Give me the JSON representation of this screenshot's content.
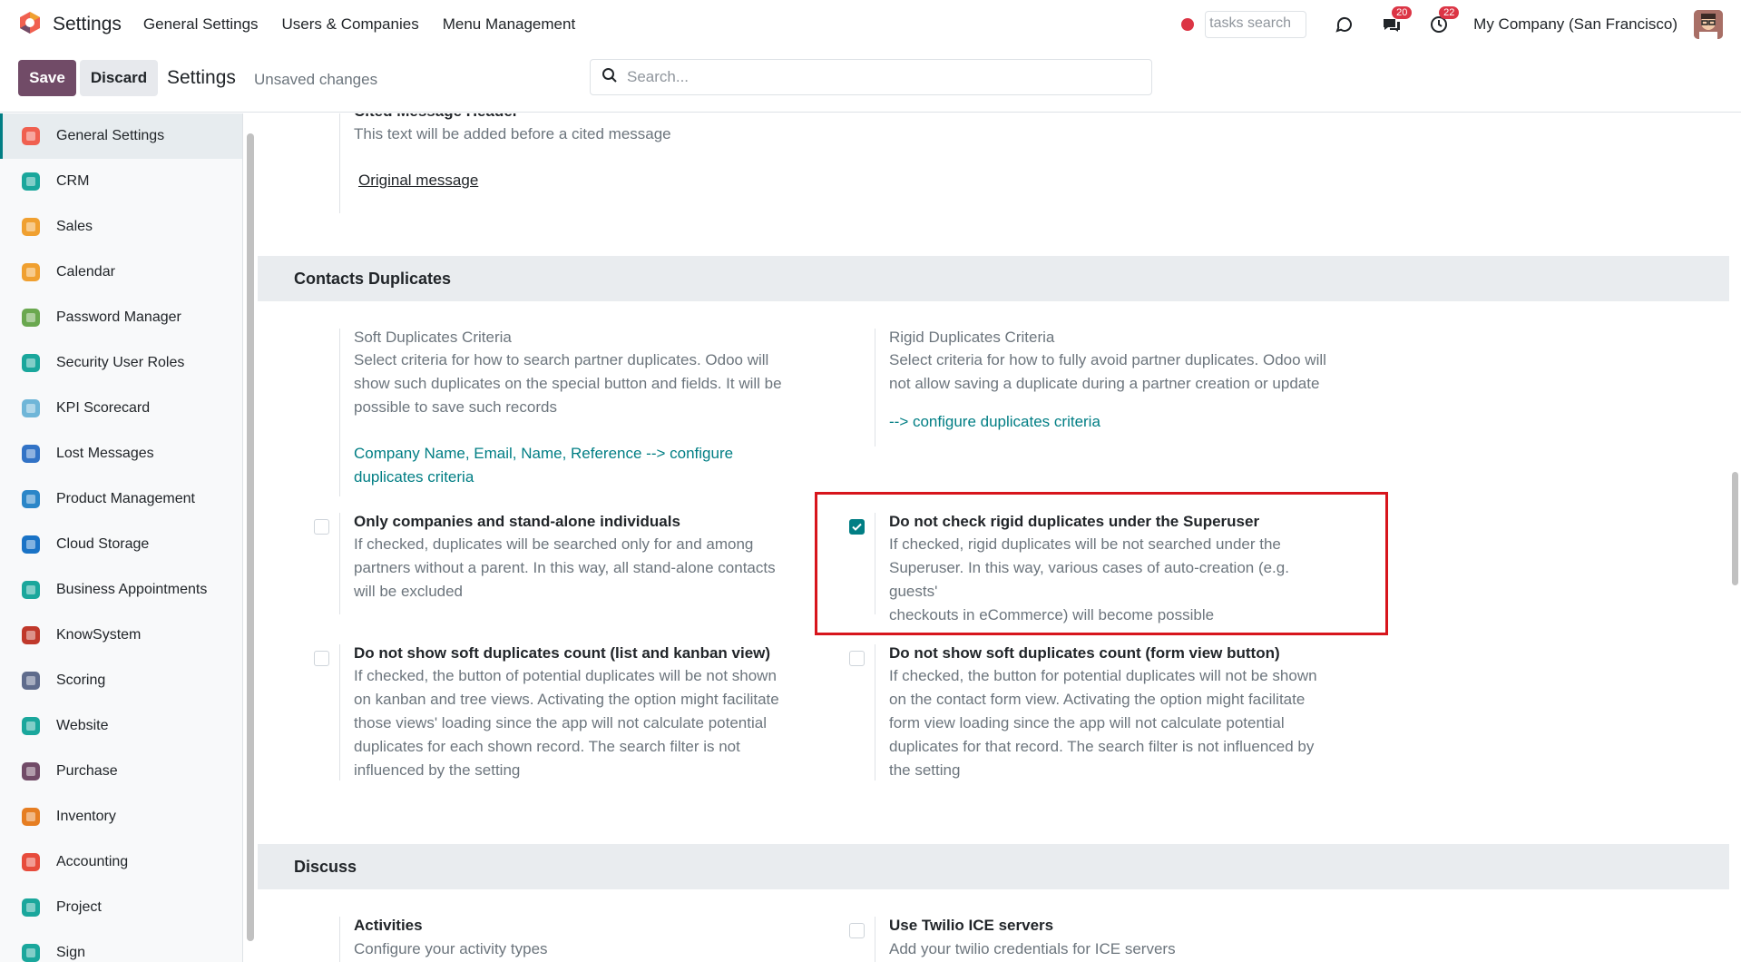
{
  "navbar": {
    "app_title": "Settings",
    "menus": [
      "General Settings",
      "Users & Companies",
      "Menu Management"
    ],
    "tasks_search_placeholder": "tasks search",
    "chat_badge": "20",
    "activity_badge": "22",
    "company": "My Company (San Francisco)"
  },
  "control_panel": {
    "save_label": "Save",
    "discard_label": "Discard",
    "title": "Settings",
    "status": "Unsaved changes",
    "search_placeholder": "Search..."
  },
  "sidebar": {
    "items": [
      {
        "label": "General Settings",
        "icon": "odoo-icon",
        "color": "#f06050"
      },
      {
        "label": "CRM",
        "icon": "crm-icon",
        "color": "#1aa79c"
      },
      {
        "label": "Sales",
        "icon": "sales-icon",
        "color": "#f0a030"
      },
      {
        "label": "Calendar",
        "icon": "calendar-icon",
        "color": "#f0a030"
      },
      {
        "label": "Password Manager",
        "icon": "password-icon",
        "color": "#6aa84f"
      },
      {
        "label": "Security User Roles",
        "icon": "security-icon",
        "color": "#1aa79c"
      },
      {
        "label": "KPI Scorecard",
        "icon": "kpi-icon",
        "color": "#6fb6d8"
      },
      {
        "label": "Lost Messages",
        "icon": "user-icon",
        "color": "#3273c6"
      },
      {
        "label": "Product Management",
        "icon": "product-icon",
        "color": "#2a86c8"
      },
      {
        "label": "Cloud Storage",
        "icon": "cloud-icon",
        "color": "#1a73c6"
      },
      {
        "label": "Business Appointments",
        "icon": "appointment-icon",
        "color": "#1aa79c"
      },
      {
        "label": "KnowSystem",
        "icon": "books-icon",
        "color": "#c0392b"
      },
      {
        "label": "Scoring",
        "icon": "scoring-icon",
        "color": "#5f6c8c"
      },
      {
        "label": "Website",
        "icon": "website-icon",
        "color": "#1aa79c"
      },
      {
        "label": "Purchase",
        "icon": "purchase-icon",
        "color": "#714b67"
      },
      {
        "label": "Inventory",
        "icon": "inventory-icon",
        "color": "#e67e22"
      },
      {
        "label": "Accounting",
        "icon": "accounting-icon",
        "color": "#e74c3c"
      },
      {
        "label": "Project",
        "icon": "project-icon",
        "color": "#1aa79c"
      },
      {
        "label": "Sign",
        "icon": "sign-icon",
        "color": "#1aa79c"
      }
    ]
  },
  "main": {
    "cited": {
      "partial_title": "Cited Message Header",
      "desc": "This text will be added before a cited message",
      "link": "Original message"
    },
    "contacts_duplicates": {
      "header": "Contacts Duplicates",
      "soft": {
        "title": "Soft Duplicates Criteria",
        "desc_lines": [
          "Select criteria for how to search partner duplicates. Odoo will",
          "show such duplicates on the special button and fields. It will be",
          "possible to save such records"
        ],
        "link_lines": [
          "Company Name, Email, Name, Reference --> configure",
          "duplicates criteria"
        ]
      },
      "rigid": {
        "title": "Rigid Duplicates Criteria",
        "desc_lines": [
          "Select criteria for how to fully avoid partner duplicates. Odoo will",
          "not allow saving a duplicate during a partner creation or update"
        ],
        "link": "--> configure duplicates criteria"
      },
      "only_companies": {
        "title": "Only companies and stand-alone individuals",
        "checked": false,
        "desc_lines": [
          "If checked, duplicates will be searched only for and among",
          "partners without a parent. In this way, all stand-alone contacts",
          "will be excluded"
        ]
      },
      "no_rigid_superuser": {
        "title": "Do not check rigid duplicates under the Superuser",
        "checked": true,
        "desc_lines": [
          "If checked, rigid duplicates will be not searched under the",
          "Superuser. In this way, various cases of auto-creation (e.g. guests'",
          "checkouts in eCommerce) will become possible"
        ]
      },
      "no_soft_list": {
        "title": "Do not show soft duplicates count (list and kanban view)",
        "checked": false,
        "desc_lines": [
          "If checked, the button of potential duplicates will be not shown",
          "on kanban and tree views. Activating the option might facilitate",
          "those views' loading since the app will not calculate potential",
          "duplicates for each shown record. The search filter is not",
          "influenced by the setting"
        ]
      },
      "no_soft_form": {
        "title": "Do not show soft duplicates count (form view button)",
        "checked": false,
        "desc_lines": [
          "If checked, the button for potential duplicates will not be shown",
          "on the contact form view. Activating the option might facilitate",
          "form view loading since the app will not calculate potential",
          "duplicates for that record. The search filter is not influenced by",
          "the setting"
        ]
      }
    },
    "discuss": {
      "header": "Discuss",
      "activities": {
        "title": "Activities",
        "desc": "Configure your activity types"
      },
      "twilio": {
        "title": "Use Twilio ICE servers",
        "checked": false,
        "desc": "Add your twilio credentials for ICE servers"
      }
    }
  },
  "colors": {
    "brand": "#714b67",
    "accent": "#017e84",
    "highlight": "#d7151c",
    "badge": "#dc3545"
  }
}
